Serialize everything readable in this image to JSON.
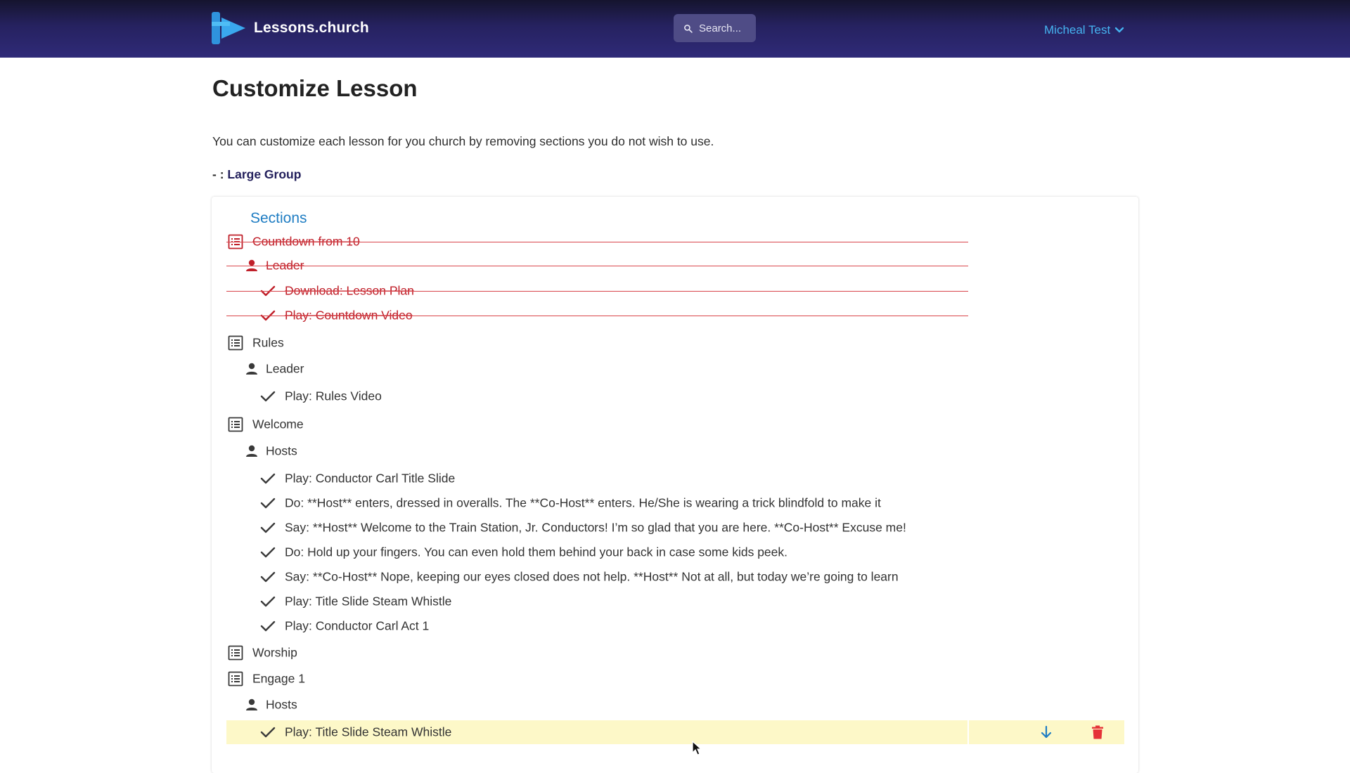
{
  "header": {
    "brand": "Lessons.church",
    "search_placeholder": "Search...",
    "user_name": "Micheal Test"
  },
  "page": {
    "title": "Customize Lesson",
    "intro": "You can customize each lesson for you church by removing sections you do not wish to use.",
    "group_prefix": "- : ",
    "group_name": "Large Group"
  },
  "sections_title": "Sections",
  "rows": [
    {
      "level": 1,
      "type": "section",
      "text": "Countdown from 10",
      "removed": true
    },
    {
      "level": 2,
      "type": "role",
      "text": "Leader",
      "removed": true
    },
    {
      "level": 3,
      "type": "action",
      "text": "Download: Lesson Plan",
      "removed": true
    },
    {
      "level": 3,
      "type": "action",
      "text": "Play: Countdown Video",
      "removed": true
    },
    {
      "level": 1,
      "type": "section",
      "text": "Rules",
      "removed": false
    },
    {
      "level": 2,
      "type": "role",
      "text": "Leader",
      "removed": false
    },
    {
      "level": 3,
      "type": "action",
      "text": "Play: Rules Video",
      "removed": false
    },
    {
      "level": 1,
      "type": "section",
      "text": "Welcome",
      "removed": false
    },
    {
      "level": 2,
      "type": "role",
      "text": "Hosts",
      "removed": false
    },
    {
      "level": 3,
      "type": "action",
      "text": "Play: Conductor Carl Title Slide",
      "removed": false
    },
    {
      "level": 3,
      "type": "action",
      "text": "Do: **Host** enters, dressed in overalls. The **Co-Host** enters. He/She is wearing a trick blindfold to make it",
      "removed": false
    },
    {
      "level": 3,
      "type": "action",
      "text": "Say: **Host** Welcome to the Train Station, Jr. Conductors! I’m so glad that you are here. **Co-Host** Excuse me!",
      "removed": false
    },
    {
      "level": 3,
      "type": "action",
      "text": "Do: Hold up your fingers. You can even hold them behind your back in case some kids peek.",
      "removed": false
    },
    {
      "level": 3,
      "type": "action",
      "text": "Say: **Co-Host** Nope, keeping our eyes closed does not help. **Host** Not at all, but today we’re going to learn",
      "removed": false
    },
    {
      "level": 3,
      "type": "action",
      "text": "Play: Title Slide Steam Whistle",
      "removed": false
    },
    {
      "level": 3,
      "type": "action",
      "text": "Play: Conductor Carl Act 1",
      "removed": false
    },
    {
      "level": 1,
      "type": "section",
      "text": "Worship",
      "removed": false
    },
    {
      "level": 1,
      "type": "section",
      "text": "Engage 1",
      "removed": false
    },
    {
      "level": 2,
      "type": "role",
      "text": "Hosts",
      "removed": false
    },
    {
      "level": 3,
      "type": "action",
      "text": "Play: Title Slide Steam Whistle",
      "removed": false,
      "highlighted": true
    }
  ],
  "colors": {
    "header_dark": "#15142e",
    "header_light": "#2f2a78",
    "accent_blue": "#1f7dc3",
    "user_blue": "#45b3f0",
    "removed_red": "#c0202a",
    "highlight": "#fdf8c8",
    "delete_red": "#e53238"
  },
  "icons": {
    "section": "list-alt-icon",
    "role": "person-icon",
    "action": "check-icon",
    "move_down": "arrow-down-icon",
    "delete": "trash-icon"
  }
}
